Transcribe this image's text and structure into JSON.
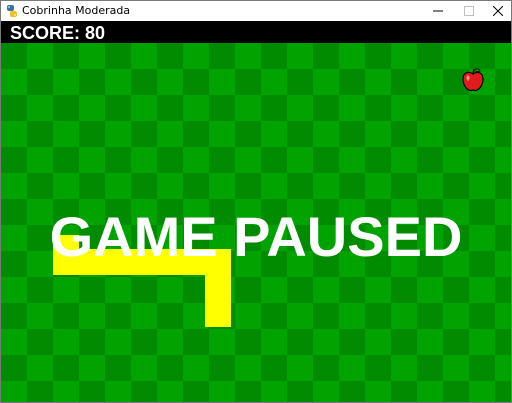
{
  "window": {
    "title": "Cobrinha Moderada",
    "icons": {
      "app": "python-app-icon",
      "minimize": "minimize-icon",
      "maximize": "maximize-icon",
      "close": "close-icon"
    }
  },
  "hud": {
    "score_text": "SCORE: 80"
  },
  "overlay": {
    "paused_text": "GAME PAUSED"
  },
  "colors": {
    "board_dark": "#008b00",
    "board_light": "#00a300",
    "snake": "#ffff00",
    "apple": "#e01b1b",
    "scorebar": "#000000",
    "text": "#ffffff"
  },
  "entities": {
    "snake_icon": "snake",
    "food_icon": "apple-icon"
  }
}
